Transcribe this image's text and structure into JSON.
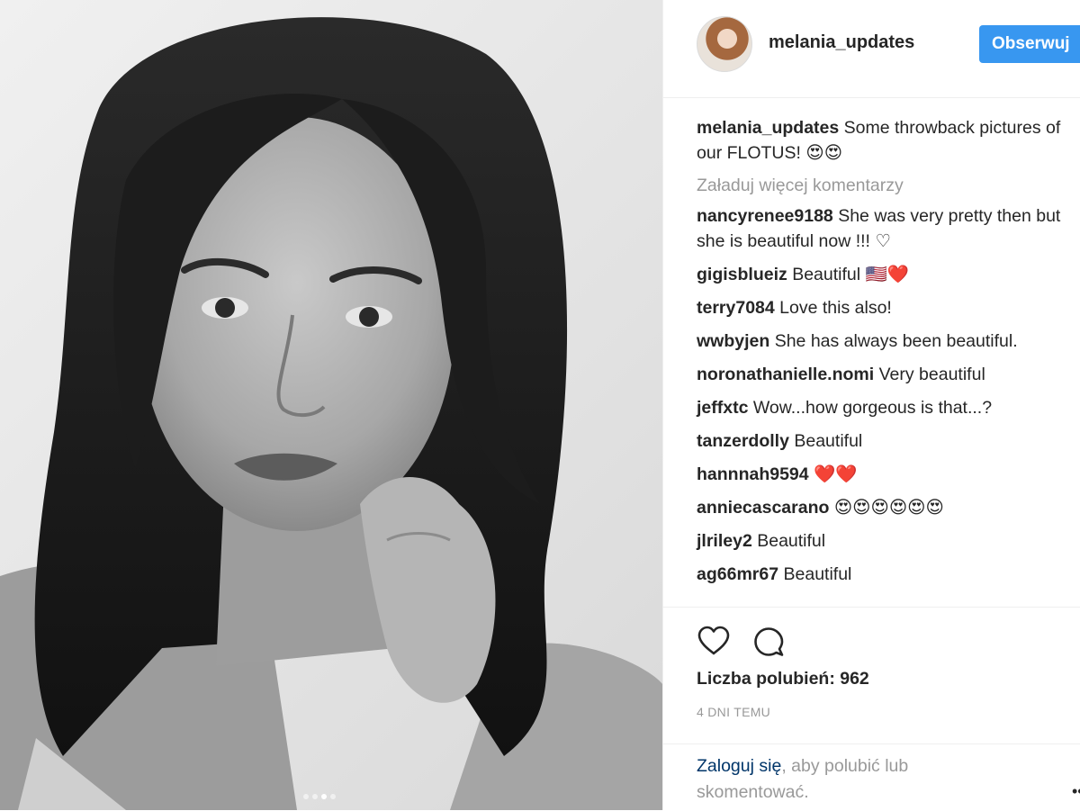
{
  "post": {
    "username": "melania_updates",
    "follow_label": "Obserwuj",
    "caption_user": "melania_updates",
    "caption_text": "Some throwback pictures of our FLOTUS! 😍😍",
    "load_more": "Załaduj więcej komentarzy",
    "comments": [
      {
        "user": "nancyrenee9188",
        "text": "She was very pretty then but she is beautiful now !!! ♡"
      },
      {
        "user": "gigisblueiz",
        "text": "Beautiful 🇺🇸❤️"
      },
      {
        "user": "terry7084",
        "text": "Love this also!"
      },
      {
        "user": "wwbyjen",
        "text": "She has always been beautiful."
      },
      {
        "user": "noronathanielle.nomi",
        "text": "Very beautiful"
      },
      {
        "user": "jeffxtc",
        "text": "Wow...how gorgeous is that...?"
      },
      {
        "user": "tanzerdolly",
        "text": "Beautiful"
      },
      {
        "user": "hannnah9594",
        "text": "❤️❤️"
      },
      {
        "user": "anniecascarano",
        "text": "😍😍😍😍😍😍"
      },
      {
        "user": "jlriley2",
        "text": "Beautiful"
      },
      {
        "user": "ag66mr67",
        "text": "Beautiful"
      }
    ],
    "likes": "Liczba polubień: 962",
    "time_ago": "4 DNI TEMU",
    "login_link": "Zaloguj się",
    "login_text": ", aby polubić lub skomentować."
  },
  "carousel": {
    "total": 4,
    "active_index": 2
  },
  "icons": {
    "like": "heart-outline-icon",
    "comment": "comment-bubble-icon",
    "more": "more-options-icon"
  },
  "colors": {
    "accent": "#3897f0",
    "link": "#003569",
    "muted": "#999999",
    "text": "#262626"
  }
}
